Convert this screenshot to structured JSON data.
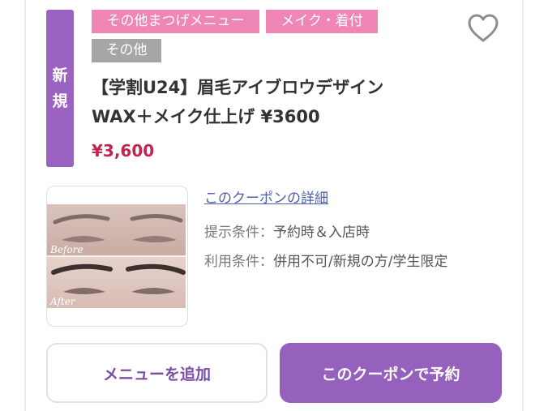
{
  "coupon": {
    "new_badge": [
      "新",
      "規"
    ],
    "tags": [
      {
        "label": "その他まつげメニュー",
        "color": "#ef86b6"
      },
      {
        "label": "メイク・着付",
        "color": "#ef86b6"
      },
      {
        "label": "その他",
        "color": "#a6a6a6"
      }
    ],
    "favorite_icon": "heart-outline-icon",
    "title_line1": "【学割U24】眉毛アイブロウデザイン",
    "title_line2": "WAX＋メイク仕上げ ¥3600",
    "price": "¥3,600",
    "photo": {
      "before_label": "Before",
      "after_label": "After"
    },
    "detail_link": "このクーポンの詳細",
    "conditions": [
      {
        "label": "提示条件：",
        "value": "予約時＆入店時"
      },
      {
        "label": "利用条件：",
        "value": "併用不可/新規の方/学生限定"
      }
    ]
  },
  "actions": {
    "add_menu": "メニューを追加",
    "reserve": "このクーポンで予約"
  },
  "colors": {
    "accent_purple": "#9561bd",
    "tag_pink": "#ef86b6",
    "tag_gray": "#a6a6a6",
    "price_red": "#c0264f"
  }
}
